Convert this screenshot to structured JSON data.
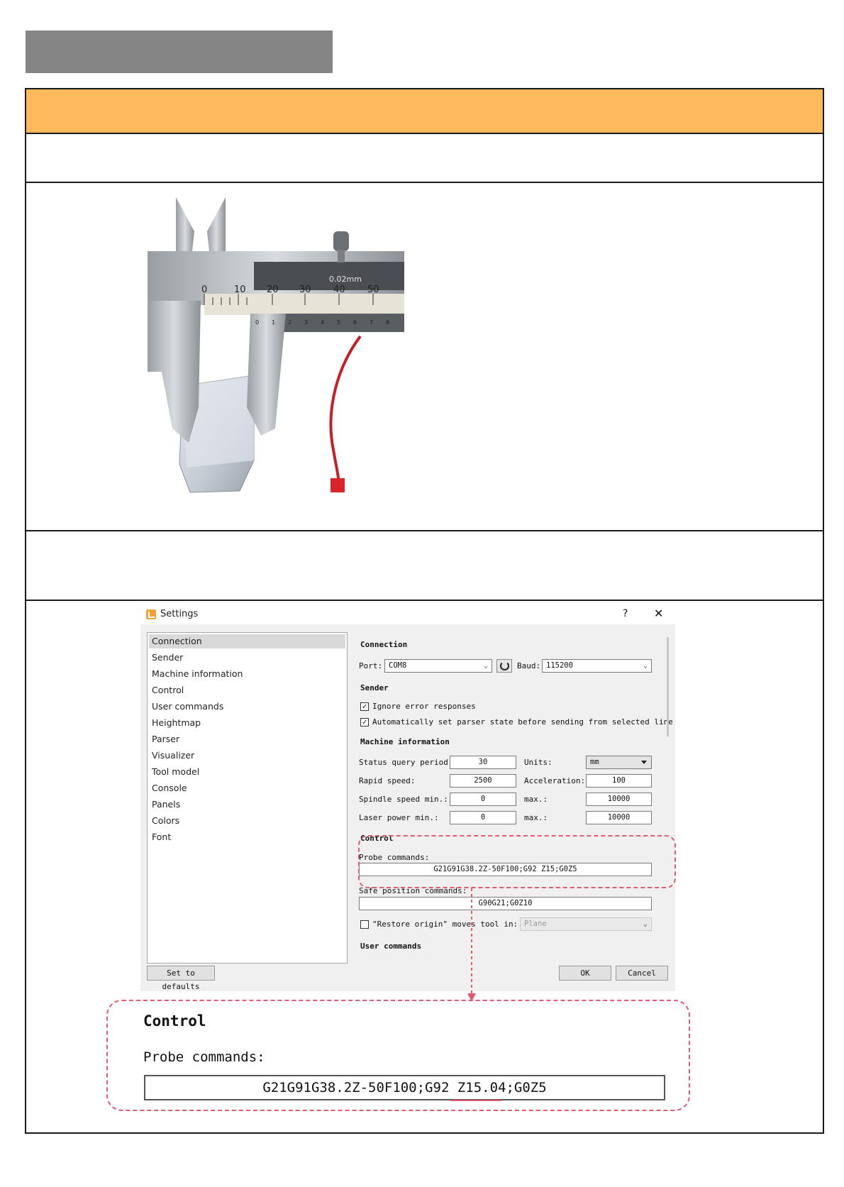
{
  "settings": {
    "title": "Settings",
    "nav": [
      "Connection",
      "Sender",
      "Machine information",
      "Control",
      "User commands",
      "Heightmap",
      "Parser",
      "Visualizer",
      "Tool model",
      "Console",
      "Panels",
      "Colors",
      "Font"
    ],
    "connection": {
      "heading": "Connection",
      "port_label": "Port:",
      "port_value": "COM8",
      "baud_label": "Baud:",
      "baud_value": "115200"
    },
    "sender": {
      "heading": "Sender",
      "ignore_errors": "Ignore error responses",
      "auto_parser": "Automatically set parser state before sending from selected line"
    },
    "machine": {
      "heading": "Machine information",
      "status_query_label": "Status query period:",
      "status_query_value": "30",
      "units_label": "Units:",
      "units_value": "mm",
      "rapid_label": "Rapid speed:",
      "rapid_value": "2500",
      "accel_label": "Acceleration:",
      "accel_value": "100",
      "spindle_min_label": "Spindle speed min.:",
      "spindle_min_value": "0",
      "spindle_max_label": "max.:",
      "spindle_max_value": "10000",
      "laser_min_label": "Laser power min.:",
      "laser_min_value": "0",
      "laser_max_label": "max.:",
      "laser_max_value": "10000"
    },
    "control": {
      "heading": "Control",
      "probe_label": "Probe commands:",
      "probe_value": "G21G91G38.2Z-50F100;G92 Z15;G0Z5",
      "safe_label": "Safe position commands:",
      "safe_value": "G90G21;G0Z10",
      "restore_label": "\"Restore origin\" moves tool in:",
      "restore_value": "Plane"
    },
    "user_commands_heading": "User commands",
    "defaults_button": "Set to defaults",
    "ok_button": "OK",
    "cancel_button": "Cancel"
  },
  "zoom": {
    "heading": "Control",
    "probe_label": "Probe commands:",
    "probe_value": "G21G91G38.2Z-50F100;G92 Z15.04;G0Z5"
  },
  "colors": {
    "header": "#ffb85a",
    "highlight": "#e05c74"
  }
}
